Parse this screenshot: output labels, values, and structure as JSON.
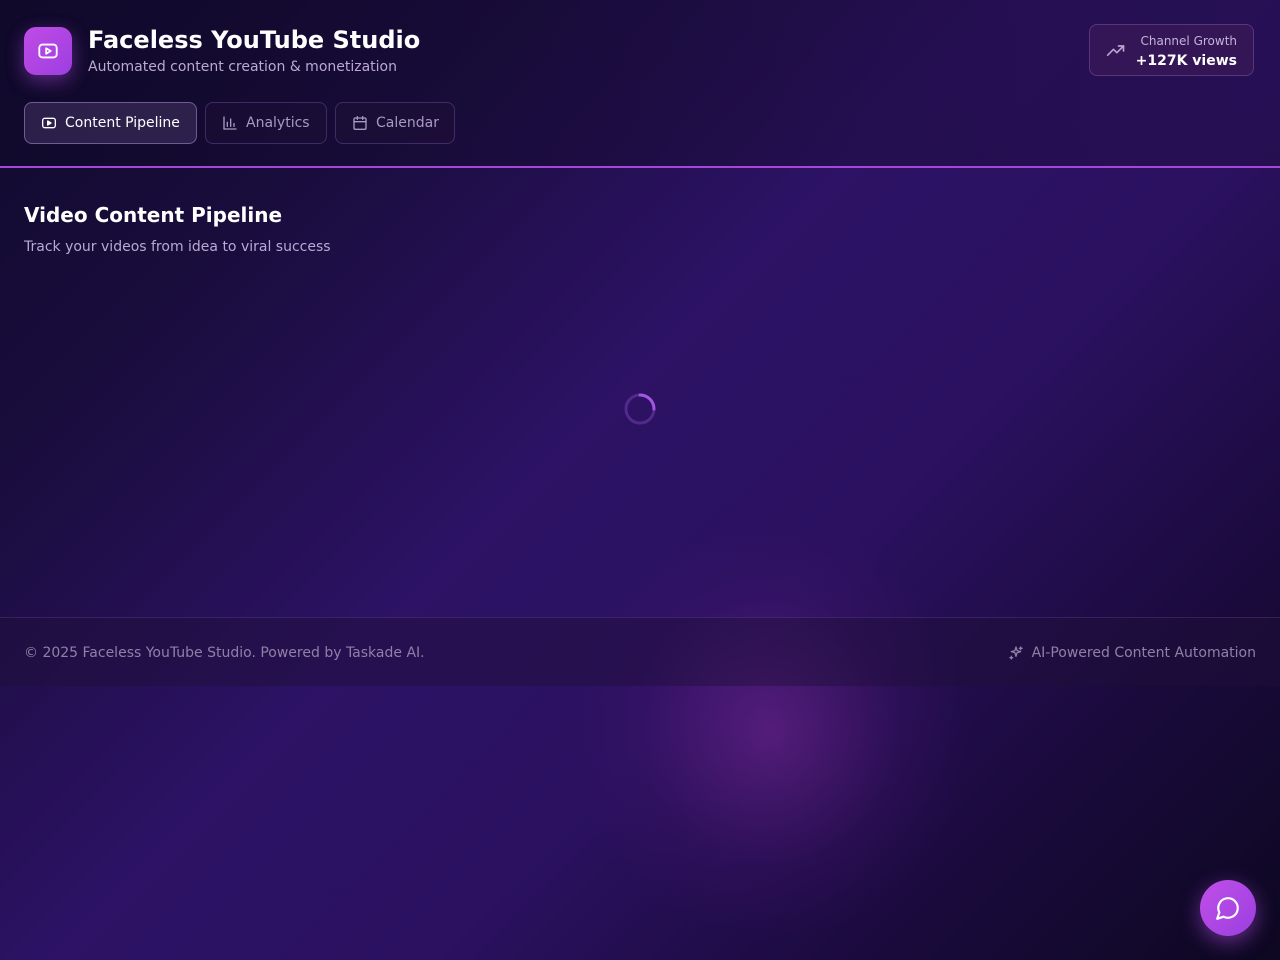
{
  "header": {
    "title": "Faceless YouTube Studio",
    "subtitle": "Automated content creation & monetization",
    "logo_icon": "youtube-play-icon",
    "growth": {
      "label": "Channel Growth",
      "value": "+127K views",
      "icon": "trending-up-icon"
    }
  },
  "tabs": [
    {
      "label": "Content Pipeline",
      "icon": "video-icon",
      "active": true
    },
    {
      "label": "Analytics",
      "icon": "bar-chart-icon",
      "active": false
    },
    {
      "label": "Calendar",
      "icon": "calendar-icon",
      "active": false
    }
  ],
  "main": {
    "title": "Video Content Pipeline",
    "subtitle": "Track your videos from idea to viral success",
    "loading": true
  },
  "footer": {
    "copyright": "© 2025 Faceless YouTube Studio. Powered by Taskade AI.",
    "tagline": "AI-Powered Content Automation",
    "tagline_icon": "sparkles-icon"
  },
  "chat": {
    "icon": "chat-bubble-icon"
  },
  "colors": {
    "accent": "#b24ae4",
    "background_dark": "#100a2c",
    "background_mid": "#2d1265",
    "text_muted": "#b9a9d3"
  }
}
